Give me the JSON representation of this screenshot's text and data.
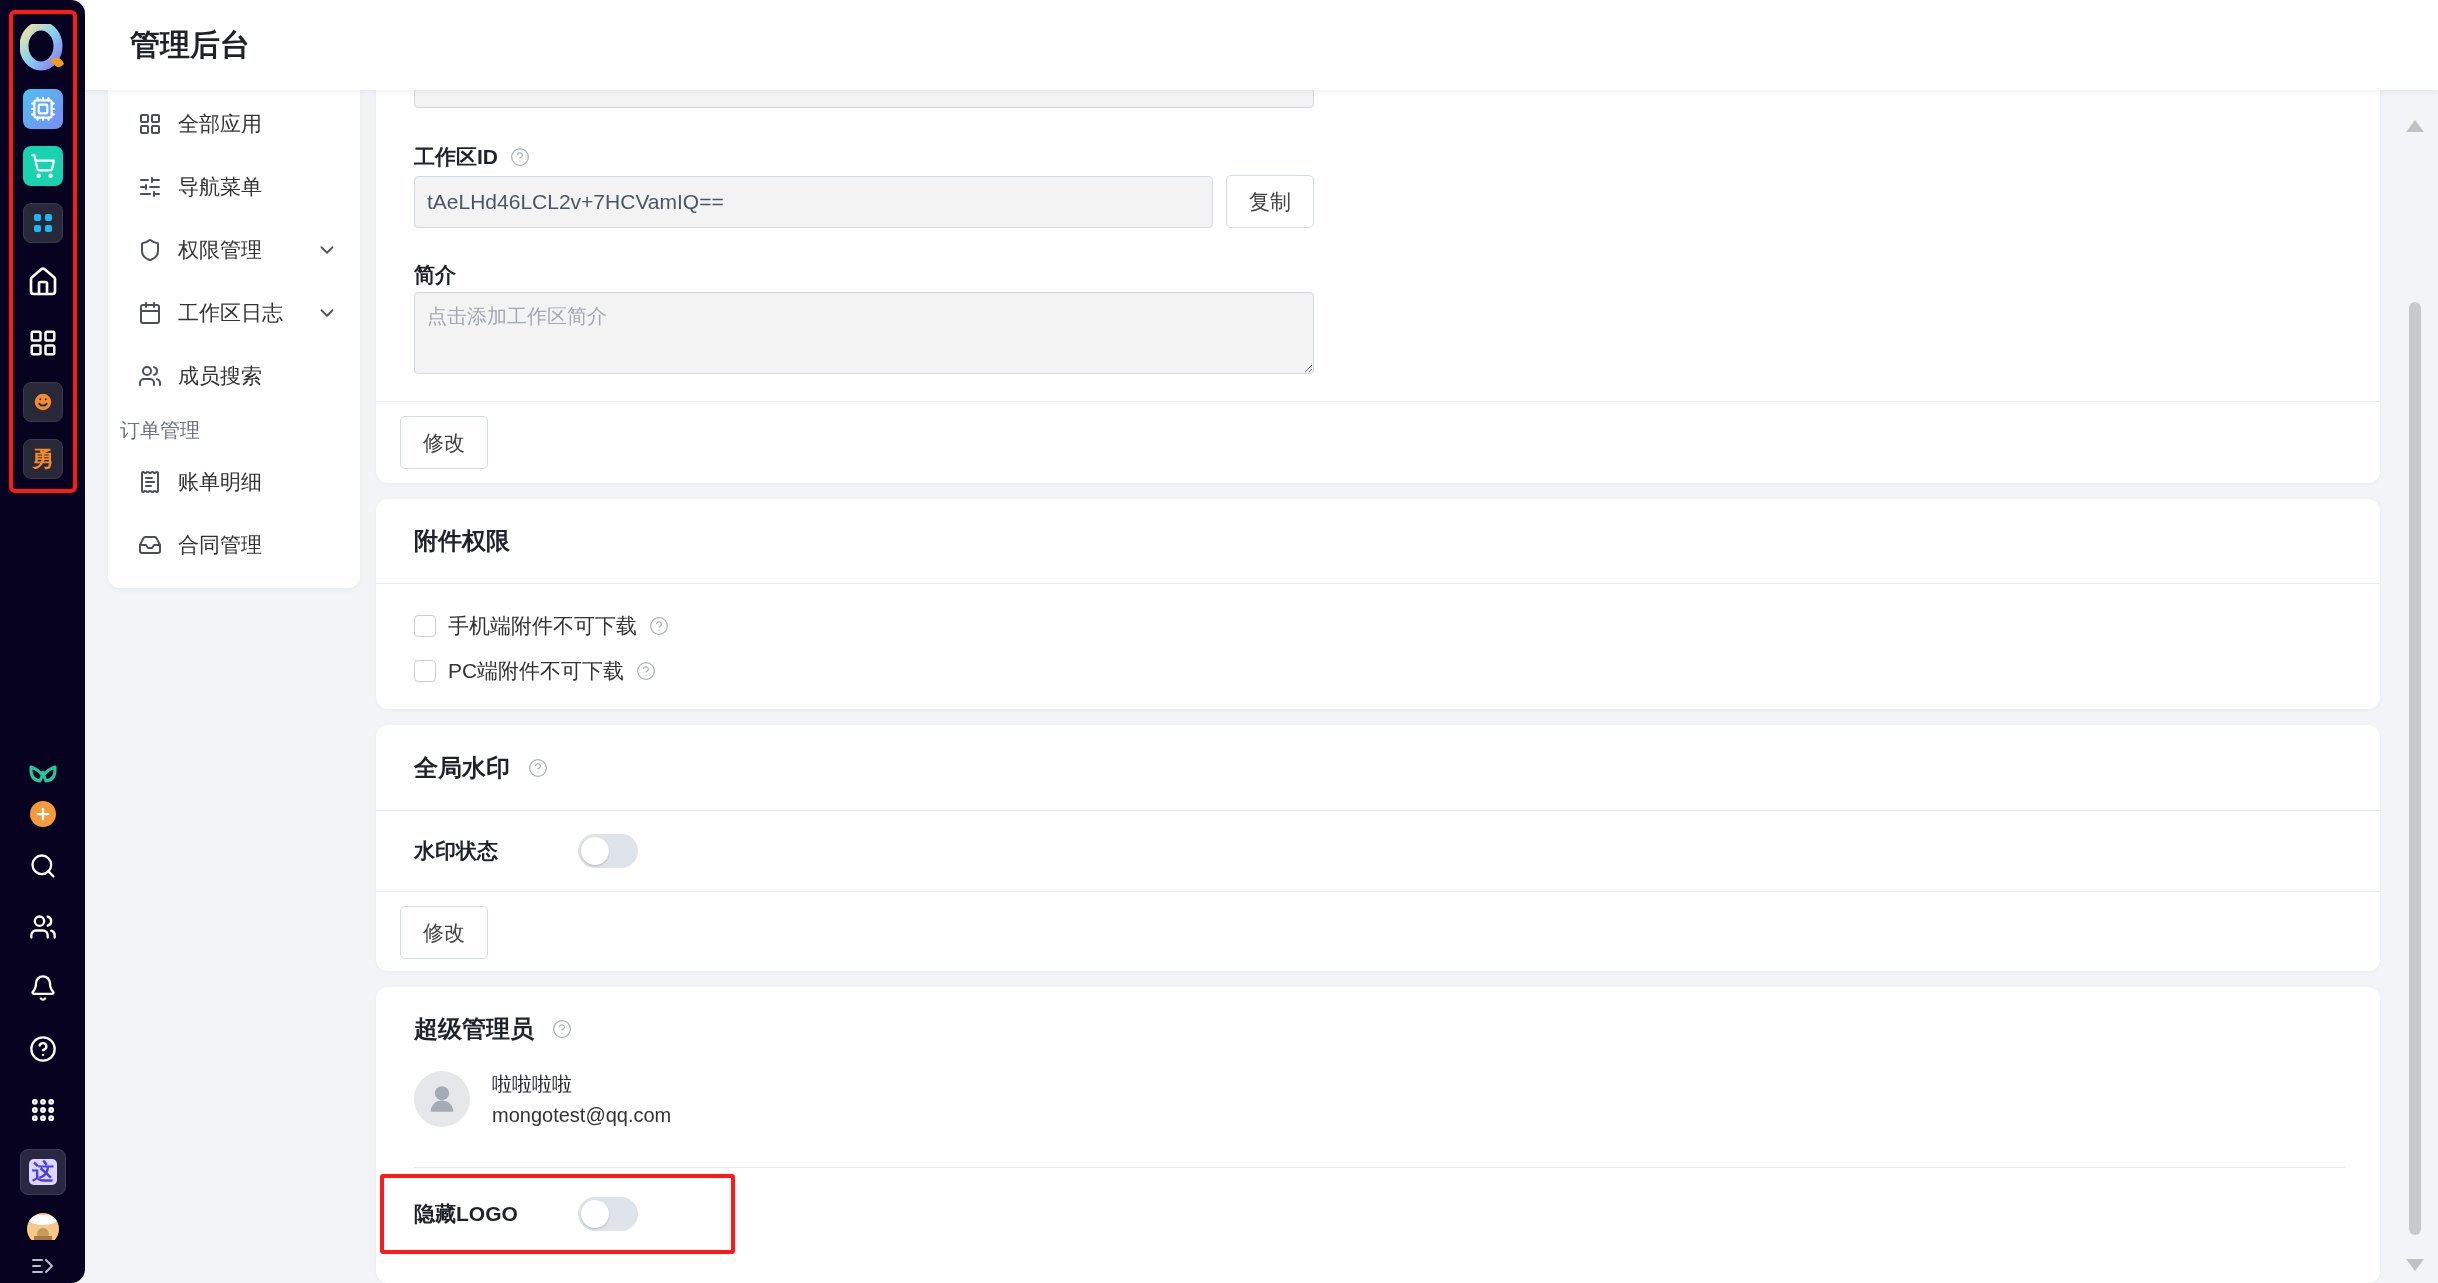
{
  "header": {
    "title": "管理后台"
  },
  "rail": {
    "highlighted": true,
    "top_badge": "勇",
    "bottom_badge": "这"
  },
  "nav": {
    "sections": [
      {
        "items": [
          {
            "label": "全部应用",
            "kind": "link"
          },
          {
            "label": "导航菜单",
            "kind": "link"
          },
          {
            "label": "权限管理",
            "kind": "submenu",
            "expanded": false
          },
          {
            "label": "工作区日志",
            "kind": "submenu",
            "expanded": false
          },
          {
            "label": "成员搜索",
            "kind": "link"
          }
        ]
      },
      {
        "title": "订单管理",
        "items": [
          {
            "label": "账单明细",
            "kind": "link"
          },
          {
            "label": "合同管理",
            "kind": "link"
          }
        ]
      }
    ]
  },
  "workspace": {
    "id_label": "工作区ID",
    "id_value": "tAeLHd46LCL2v+7HCVamIQ==",
    "copy_button": "复制",
    "intro_label": "简介",
    "intro_placeholder": "点击添加工作区简介",
    "submit_button": "修改"
  },
  "attachments": {
    "title": "附件权限",
    "options": [
      {
        "label": "手机端附件不可下载",
        "checked": false
      },
      {
        "label": "PC端附件不可下载",
        "checked": false
      }
    ]
  },
  "watermark": {
    "title": "全局水印",
    "status_label": "水印状态",
    "status_on": false,
    "submit_button": "修改"
  },
  "super_admin": {
    "title": "超级管理员",
    "name": "啦啦啦啦",
    "email": "mongotest@qq.com",
    "hide_logo_label": "隐藏LOGO",
    "hide_logo_on": false,
    "hide_logo_highlighted": true
  }
}
